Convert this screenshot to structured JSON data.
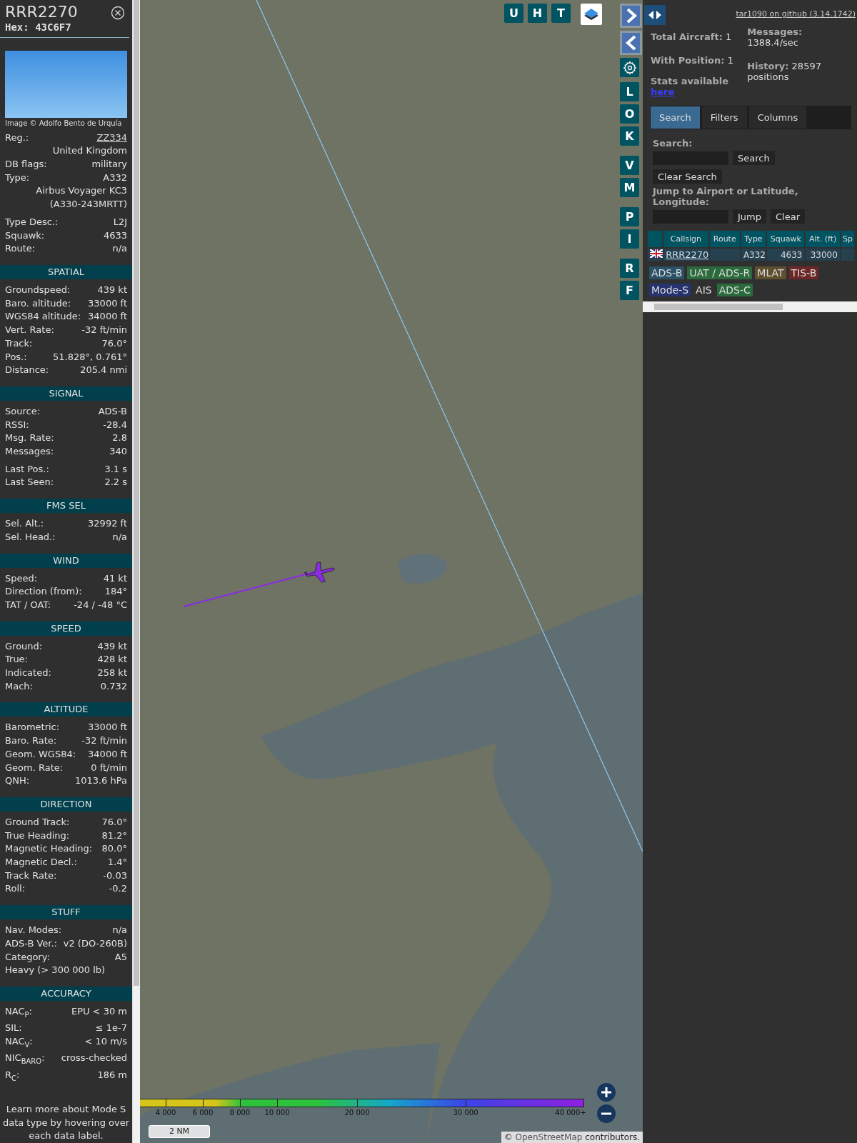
{
  "aircraft": {
    "callsign": "RRR2270",
    "hex": "Hex: 43C6F7",
    "photo_credit": "Image © Adolfo Bento de Urquía"
  },
  "info_groups": [
    [
      {
        "kind": "link",
        "label": "Reg.:",
        "value": "ZZ334"
      },
      {
        "kind": "value",
        "value": "United Kingdom"
      },
      {
        "kind": "pair",
        "label": "DB flags:",
        "value": "military"
      },
      {
        "kind": "pair",
        "label": "Type:",
        "value": "A332"
      },
      {
        "kind": "value",
        "value": "Airbus Voyager KC3 (A330-243MRTT)"
      }
    ],
    [
      {
        "kind": "pair",
        "label": "Type Desc.:",
        "value": "L2J"
      },
      {
        "kind": "pair",
        "label": "Squawk:",
        "value": "4633"
      },
      {
        "kind": "pair",
        "label": "Route:",
        "value": "n/a"
      }
    ]
  ],
  "sections": [
    {
      "title": "SPATIAL",
      "groups": [
        [
          {
            "kind": "pair",
            "label": "Groundspeed:",
            "value": "439 kt"
          },
          {
            "kind": "pair",
            "label": "Baro. altitude:",
            "value": "33000 ft"
          },
          {
            "kind": "pair",
            "label": "WGS84 altitude:",
            "value": "34000 ft"
          },
          {
            "kind": "pair",
            "label": "Vert. Rate:",
            "value": "-32 ft/min"
          },
          {
            "kind": "pair",
            "label": "Track:",
            "value": "76.0°"
          },
          {
            "kind": "pair",
            "label": "Pos.:",
            "value": "51.828°, 0.761°"
          },
          {
            "kind": "pair",
            "label": "Distance:",
            "value": "205.4 nmi"
          }
        ]
      ]
    },
    {
      "title": "SIGNAL",
      "groups": [
        [
          {
            "kind": "pair",
            "label": "Source:",
            "value": "ADS-B"
          },
          {
            "kind": "pair",
            "label": "RSSI:",
            "value": "-28.4"
          },
          {
            "kind": "pair",
            "label": "Msg. Rate:",
            "value": "2.8"
          },
          {
            "kind": "pair",
            "label": "Messages:",
            "value": "340"
          }
        ],
        [
          {
            "kind": "pair",
            "label": "Last Pos.:",
            "value": "3.1 s"
          },
          {
            "kind": "pair",
            "label": "Last Seen:",
            "value": "2.2 s"
          }
        ]
      ]
    },
    {
      "title": "FMS SEL",
      "groups": [
        [
          {
            "kind": "pair",
            "label": "Sel. Alt.:",
            "value": "32992 ft"
          },
          {
            "kind": "pair",
            "label": "Sel. Head.:",
            "value": "n/a"
          }
        ]
      ]
    },
    {
      "title": "WIND",
      "groups": [
        [
          {
            "kind": "pair",
            "label": "Speed:",
            "value": "41 kt"
          },
          {
            "kind": "pair",
            "label": "Direction (from):",
            "value": "184°"
          },
          {
            "kind": "pair",
            "label": "TAT / OAT:",
            "value": "-24 / -48 °C"
          }
        ]
      ]
    },
    {
      "title": "SPEED",
      "groups": [
        [
          {
            "kind": "pair",
            "label": "Ground:",
            "value": "439 kt"
          },
          {
            "kind": "pair",
            "label": "True:",
            "value": "428 kt"
          },
          {
            "kind": "pair",
            "label": "Indicated:",
            "value": "258 kt"
          },
          {
            "kind": "pair",
            "label": "Mach:",
            "value": "0.732"
          }
        ]
      ]
    },
    {
      "title": "ALTITUDE",
      "groups": [
        [
          {
            "kind": "pair",
            "label": "Barometric:",
            "value": "33000 ft"
          },
          {
            "kind": "pair",
            "label": "Baro. Rate:",
            "value": "-32 ft/min"
          },
          {
            "kind": "pair",
            "label": "Geom. WGS84:",
            "value": "34000 ft"
          },
          {
            "kind": "pair",
            "label": "Geom. Rate:",
            "value": "0 ft/min"
          },
          {
            "kind": "pair",
            "label": "QNH:",
            "value": "1013.6 hPa"
          }
        ]
      ]
    },
    {
      "title": "DIRECTION",
      "groups": [
        [
          {
            "kind": "pair",
            "label": "Ground Track:",
            "value": "76.0°"
          },
          {
            "kind": "pair",
            "label": "True Heading:",
            "value": "81.2°"
          },
          {
            "kind": "pair",
            "label": "Magnetic Heading:",
            "value": "80.0°"
          },
          {
            "kind": "pair",
            "label": "Magnetic Decl.:",
            "value": "1.4°"
          },
          {
            "kind": "pair",
            "label": "Track Rate:",
            "value": "-0.03"
          },
          {
            "kind": "pair",
            "label": "Roll:",
            "value": "-0.2"
          }
        ]
      ]
    },
    {
      "title": "STUFF",
      "groups": [
        [
          {
            "kind": "pair",
            "label": "Nav. Modes:",
            "value": "n/a"
          },
          {
            "kind": "pair",
            "label": "ADS-B Ver.:",
            "value": "v2 (DO-260B)"
          },
          {
            "kind": "pair",
            "label": "Category:",
            "value": "A5"
          },
          {
            "kind": "label",
            "label": "Heavy (> 300 000 lb)"
          }
        ]
      ]
    },
    {
      "title": "ACCURACY",
      "groups": [
        [
          {
            "kind": "pair",
            "label": "NAC$_{P}$:",
            "value": "EPU < 30 m"
          },
          {
            "kind": "pair",
            "label": "SIL:",
            "value": "≤ 1e-7"
          },
          {
            "kind": "pair",
            "label": "NAC$_{V}$:",
            "value": "< 10 m/s"
          },
          {
            "kind": "pair",
            "label": "NIC$_{BARO}$:",
            "value": "cross-checked"
          },
          {
            "kind": "pair",
            "label": "R$_{C}$:",
            "value": "186 m"
          }
        ]
      ]
    }
  ],
  "footer_note": "Learn more about Mode S data type by hovering over each data label.",
  "map": {
    "top_buttons": [
      "U",
      "H",
      "T"
    ],
    "side_buttons": [
      [
        "L",
        "O",
        "K"
      ],
      [
        "V",
        "M"
      ],
      [
        "P",
        "I"
      ],
      [
        "R",
        "F"
      ]
    ],
    "legend_ticks": [
      "4 000",
      "6 000",
      "8 000",
      "10 000",
      "20 000",
      "30 000",
      "40 000+"
    ],
    "scale": "2 NM",
    "attribution": {
      "prefix": "©",
      "link": "OpenStreetMap",
      "suffix": "contributors."
    }
  },
  "side_panel": {
    "github_link": "tar1090 on github (3.14.1742)",
    "stats_columns": [
      [
        {
          "text": "**Total Aircraft:** 1"
        },
        {
          "text": "**With Position:** 1"
        }
      ],
      [
        {
          "text": "**Messages:** 1388.4/sec"
        },
        {
          "text": "**History:** 28597 positions"
        }
      ]
    ],
    "stats_note": "Stats available",
    "stats_link": "here",
    "tabs": [
      {
        "label": "Search",
        "selected": true
      },
      {
        "label": "Filters",
        "selected": false
      },
      {
        "label": "Columns",
        "selected": false
      }
    ],
    "search_label": "Search:",
    "search_button": "Search",
    "clear_search_button": "Clear Search",
    "jump_label": "Jump to Airport or Latitude, Longitude:",
    "jump_button": "Jump",
    "clear_button": "Clear",
    "table": {
      "columns": [
        "Callsign",
        "Route",
        "Type",
        "Squawk",
        "Alt. (ft)",
        "Sp"
      ],
      "rows": [
        {
          "callsign": "RRR2270",
          "route": "",
          "type": "A332",
          "squawk": "4633",
          "altitude": "33000"
        }
      ]
    },
    "source_badges": [
      [
        {
          "label": "ADS-B",
          "color": "#2b5168"
        },
        {
          "label": "UAT / ADS-R",
          "color": "#2a6a3c"
        },
        {
          "label": "MLAT",
          "color": "#5e4f2f"
        },
        {
          "label": "TIS-B",
          "color": "#6d2727"
        }
      ],
      [
        {
          "label": "Mode-S",
          "color": "#26336f"
        },
        {
          "label": "AIS",
          "color": "#303030"
        },
        {
          "label": "ADS-C",
          "color": "#2a6a3c"
        }
      ]
    ]
  }
}
